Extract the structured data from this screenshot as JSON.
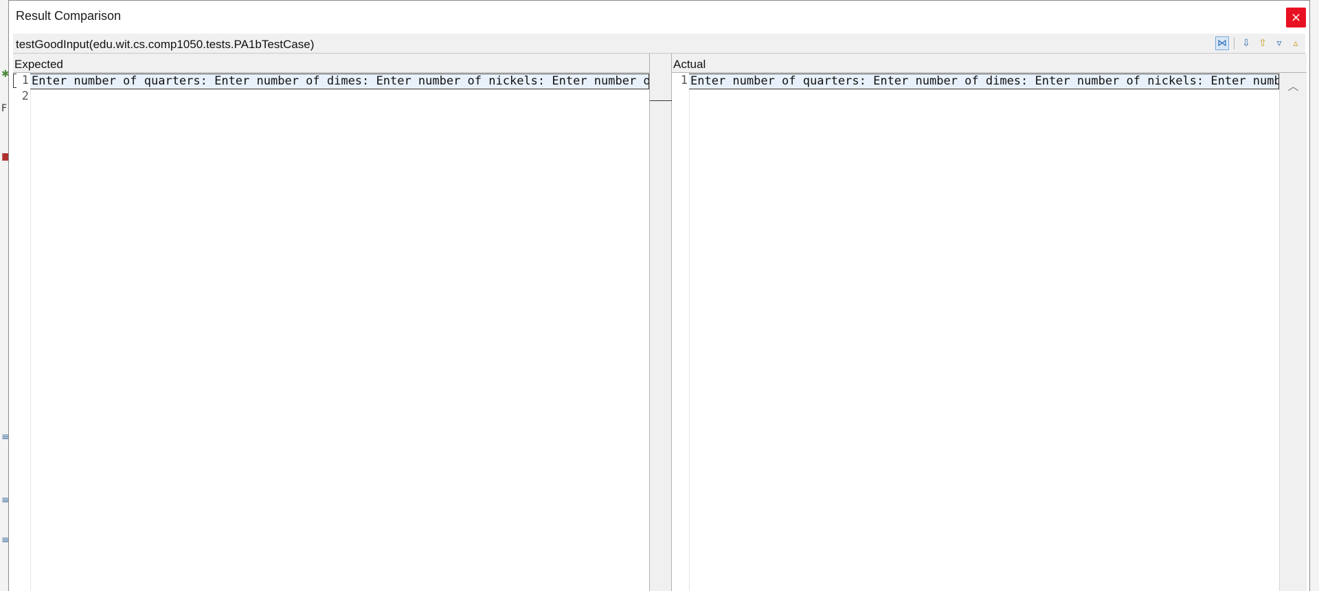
{
  "window": {
    "title": "Result Comparison",
    "close_glyph": "×"
  },
  "test": {
    "name": "testGoodInput(edu.wit.cs.comp1050.tests.PA1bTestCase)"
  },
  "toolbar": {
    "icons": [
      "compare-toggle-icon",
      "next-difference-icon",
      "previous-difference-icon",
      "next-change-icon",
      "previous-change-icon"
    ]
  },
  "expected": {
    "header": "Expected",
    "line_numbers": [
      "1",
      "2"
    ],
    "lines": [
      "Enter number of quarters: Enter number of dimes: Enter number of nickels: Enter number of pennies: "
    ]
  },
  "actual": {
    "header": "Actual",
    "line_numbers": [
      "1"
    ],
    "lines": [
      "Enter number of quarters: Enter number of dimes: Enter number of nickels: Enter number of pennies: "
    ]
  },
  "background": {
    "edge_letter": "F"
  },
  "colors": {
    "close_button": "#e81123",
    "diff_highlight": "#e8f1fb",
    "accent": "#2f6db5"
  }
}
